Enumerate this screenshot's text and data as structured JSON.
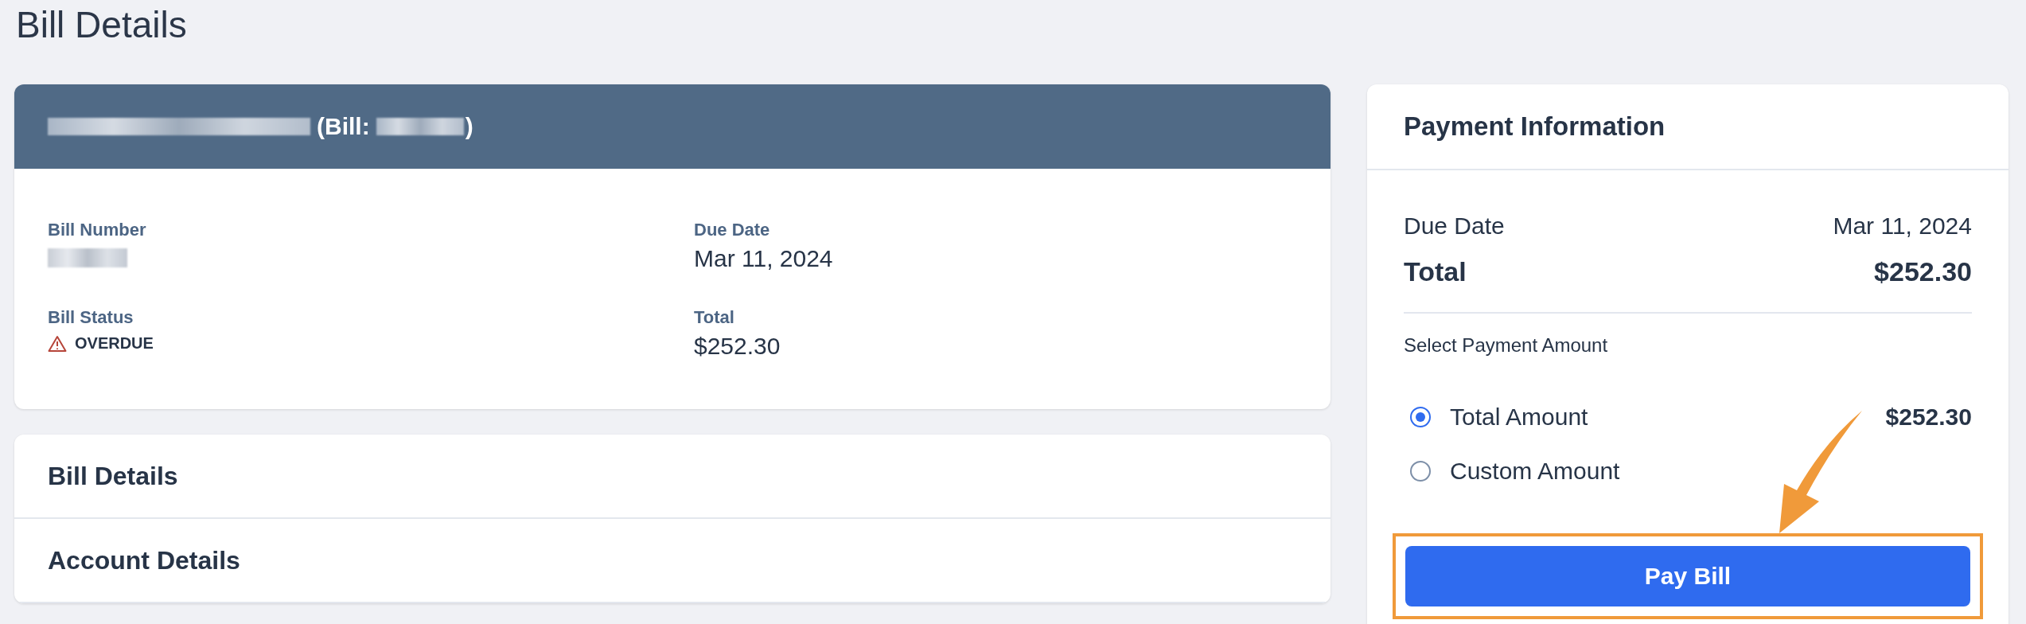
{
  "page": {
    "title": "Bill Details"
  },
  "bill_card": {
    "header": {
      "redacted_name": true,
      "bill_label": "(Bill:",
      "redacted_id": true,
      "closing": ")"
    },
    "fields": [
      {
        "label": "Bill Number",
        "kind": "redacted"
      },
      {
        "label": "Due Date",
        "kind": "text",
        "value": "Mar 11, 2024"
      },
      {
        "label": "Bill Status",
        "kind": "status",
        "value": "OVERDUE"
      },
      {
        "label": "Total",
        "kind": "text",
        "value": "$252.30"
      }
    ]
  },
  "sections": [
    {
      "title": "Bill Details"
    },
    {
      "title": "Account Details"
    }
  ],
  "payment": {
    "title": "Payment Information",
    "rows": [
      {
        "label": "Due Date",
        "value": "Mar 11, 2024",
        "kind": "normal"
      },
      {
        "label": "Total",
        "value": "$252.30",
        "kind": "total"
      }
    ],
    "select_label": "Select Payment Amount",
    "options": [
      {
        "label": "Total Amount",
        "selected": true,
        "amount": "$252.30"
      },
      {
        "label": "Custom Amount",
        "selected": false
      }
    ],
    "button": {
      "label": "Pay Bill",
      "highlighted": true
    }
  }
}
